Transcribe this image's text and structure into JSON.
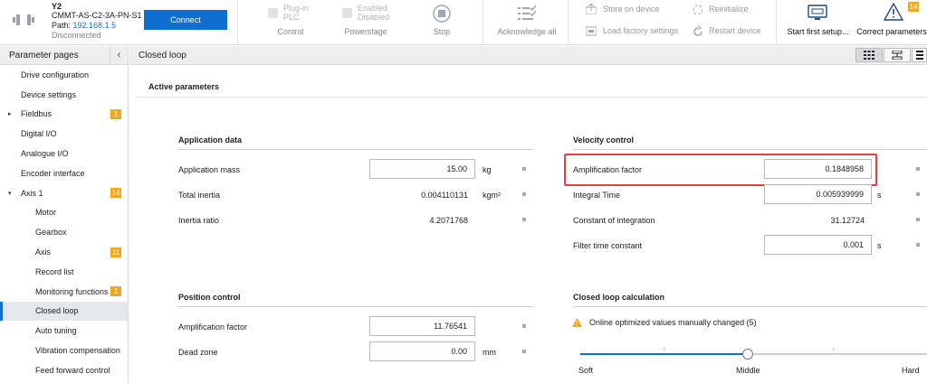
{
  "device": {
    "name": "Y2",
    "model": "CMMT-AS-C2-3A-PN-S1",
    "path_label": "Path:",
    "path_value": "192.168.1.5",
    "status": "Disconnected"
  },
  "toolbar": {
    "connect_label": "Connect",
    "plugin_label": "Plug-in",
    "plc_label": "PLC",
    "control_label": "Control",
    "enabled_label": "Enabled",
    "disabled_label": "Disabled",
    "powerstage_label": "Powerstage",
    "stop_label": "Stop",
    "acknowledge_label": "Acknowledge all",
    "store_label": "Store on device",
    "load_factory_label": "Load factory settings",
    "reinitialize_label": "Reinitialize",
    "restart_label": "Restart device",
    "first_setup_label": "Start first setup...",
    "correct_params_label": "Correct parameters",
    "correct_params_badge": "14"
  },
  "sidebar": {
    "title": "Parameter pages",
    "collapse_icon": "chevron-left-icon",
    "items": [
      {
        "label": "Drive configuration",
        "level": 1
      },
      {
        "label": "Device settings",
        "level": 1
      },
      {
        "label": "Fieldbus",
        "level": 1,
        "arrow": "▸",
        "badge": "1"
      },
      {
        "label": "Digital I/O",
        "level": 1
      },
      {
        "label": "Analogue I/O",
        "level": 1
      },
      {
        "label": "Encoder interface",
        "level": 1
      },
      {
        "label": "Axis 1",
        "level": 1,
        "arrow": "▾",
        "badge": "14"
      },
      {
        "label": "Motor",
        "level": 2
      },
      {
        "label": "Gearbox",
        "level": 2
      },
      {
        "label": "Axis",
        "level": 2,
        "badge": "11"
      },
      {
        "label": "Record list",
        "level": 2
      },
      {
        "label": "Monitoring functions",
        "level": 2,
        "badge": "1"
      },
      {
        "label": "Closed loop",
        "level": 2,
        "active": true
      },
      {
        "label": "Auto tuning",
        "level": 2
      },
      {
        "label": "Vibration compensation",
        "level": 2
      },
      {
        "label": "Feed forward control",
        "level": 2
      }
    ]
  },
  "content": {
    "title": "Closed loop",
    "active_parameters": "Active parameters",
    "application_data": {
      "title": "Application data",
      "mass_label": "Application mass",
      "mass_value": "15.00",
      "mass_unit": "kg",
      "inertia_label": "Total inertia",
      "inertia_value": "0.004110131",
      "inertia_unit": "kgm²",
      "ratio_label": "Inertia ratio",
      "ratio_value": "4.2071768"
    },
    "velocity_control": {
      "title": "Velocity control",
      "amp_label": "Amplification factor",
      "amp_value": "0.1848958",
      "integral_label": "Integral Time",
      "integral_value": "0.005939999",
      "integral_unit": "s",
      "constant_label": "Constant of integration",
      "constant_value": "31.12724",
      "filter_label": "Filter time constant",
      "filter_value": "0.001",
      "filter_unit": "s"
    },
    "position_control": {
      "title": "Position control",
      "amp_label": "Amplification factor",
      "amp_value": "11.76541",
      "dead_label": "Dead zone",
      "dead_value": "0.00",
      "dead_unit": "mm"
    },
    "closed_loop_calc": {
      "title": "Closed loop calculation",
      "warning": "Online optimized values manually changed (5)",
      "slider_soft": "Soft",
      "slider_middle": "Middle",
      "slider_hard": "Hard",
      "slider_position": 0.5
    }
  },
  "colors": {
    "accent": "#0f6fd0",
    "badge": "#f0a71c",
    "highlight": "#e34040"
  }
}
